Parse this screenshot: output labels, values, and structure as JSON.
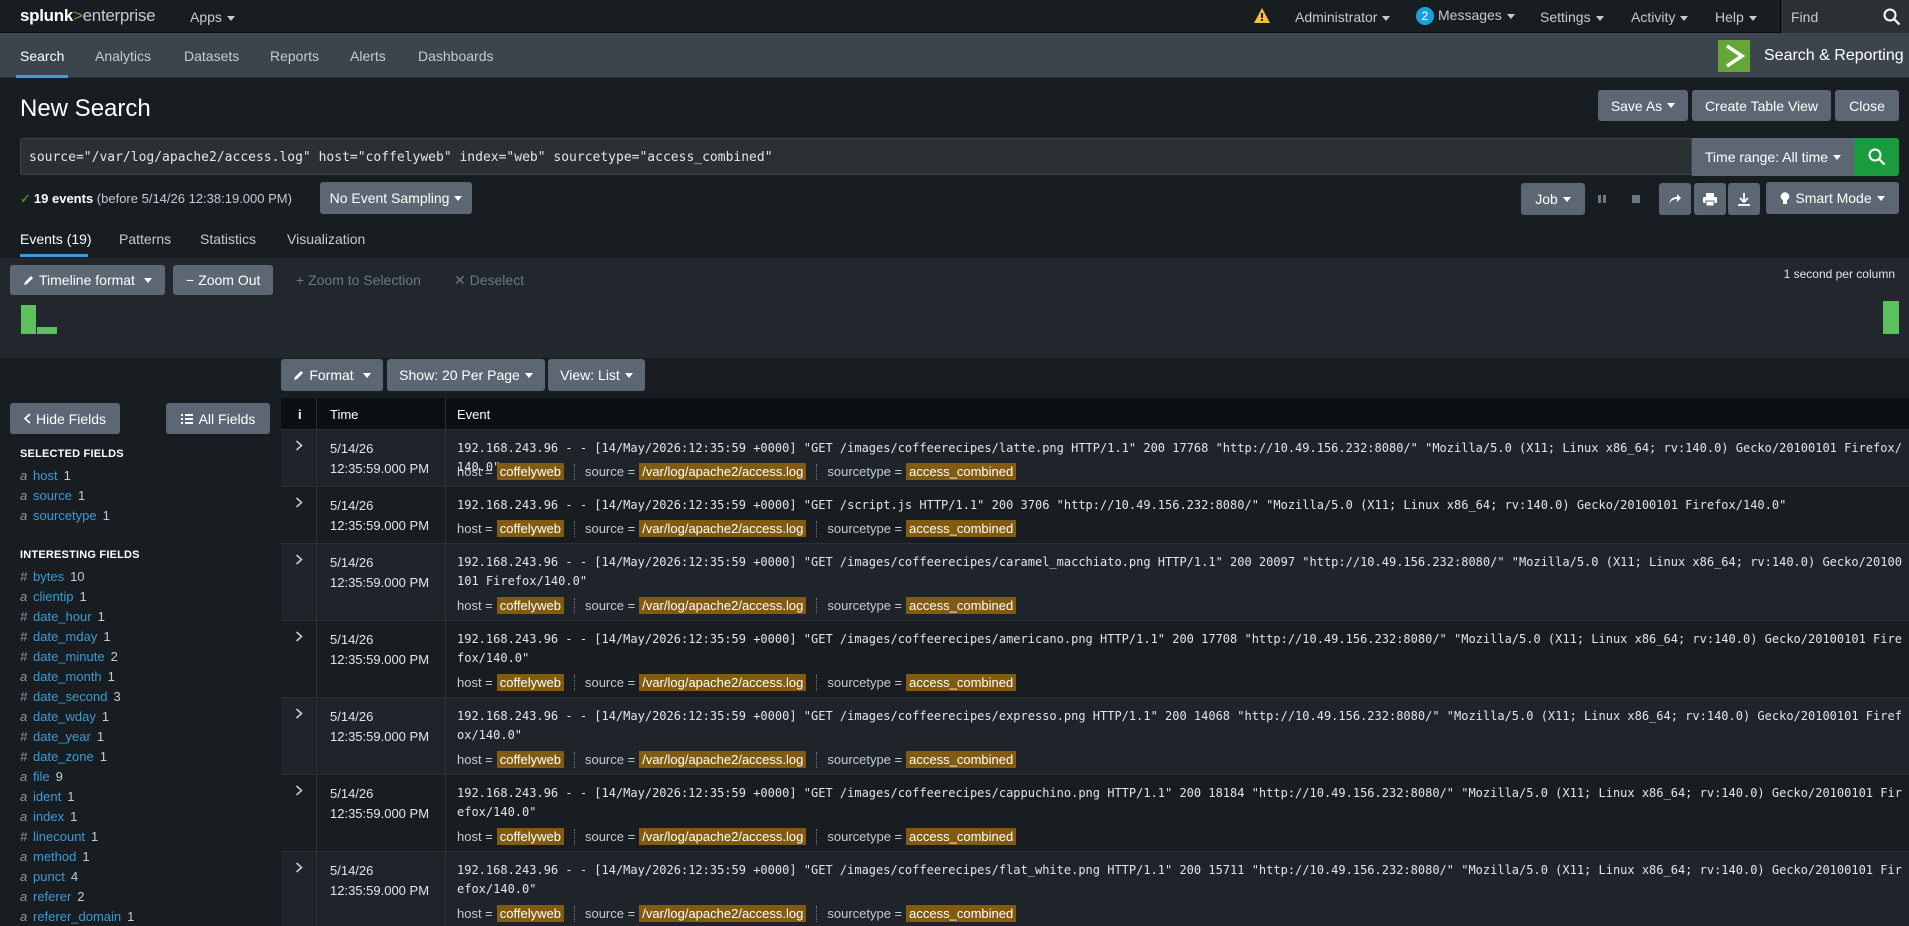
{
  "topbar": {
    "logo_splunk": "splunk",
    "logo_gt": ">",
    "logo_enterprise": "enterprise",
    "apps": "Apps",
    "user": "Administrator",
    "messages_count": "2",
    "messages": "Messages",
    "settings": "Settings",
    "activity": "Activity",
    "help": "Help",
    "find_placeholder": "Find"
  },
  "appbar": {
    "tabs": [
      "Search",
      "Analytics",
      "Datasets",
      "Reports",
      "Alerts",
      "Dashboards"
    ],
    "app_name": "Search & Reporting"
  },
  "page": {
    "title": "New Search",
    "save_as": "Save As",
    "create_table_view": "Create Table View",
    "close": "Close"
  },
  "search": {
    "query": "source=\"/var/log/apache2/access.log\" host=\"coffelyweb\" index=\"web\" sourcetype=\"access_combined\"",
    "time_range": "Time range: All time"
  },
  "status": {
    "check": "✓",
    "count": "19 events",
    "detail": "(before 5/14/26 12:38:19.000 PM)",
    "sampling": "No Event Sampling",
    "job": "Job",
    "mode": "Smart Mode"
  },
  "result_tabs": [
    "Events (19)",
    "Patterns",
    "Statistics",
    "Visualization"
  ],
  "timeline": {
    "format": "Timeline format",
    "zoom_out": "Zoom Out",
    "zoom_selection": "+ Zoom to Selection",
    "deselect": "✕ Deselect",
    "scale": "1 second per column"
  },
  "list_controls": {
    "format": "Format",
    "show": "Show: 20 Per Page",
    "view": "View: List"
  },
  "fields_panel": {
    "hide": "Hide Fields",
    "all": "All Fields",
    "selected_header": "SELECTED FIELDS",
    "selected": [
      {
        "type": "a",
        "name": "host",
        "count": "1"
      },
      {
        "type": "a",
        "name": "source",
        "count": "1"
      },
      {
        "type": "a",
        "name": "sourcetype",
        "count": "1"
      }
    ],
    "interesting_header": "INTERESTING FIELDS",
    "interesting": [
      {
        "type": "#",
        "name": "bytes",
        "count": "10"
      },
      {
        "type": "a",
        "name": "clientip",
        "count": "1"
      },
      {
        "type": "#",
        "name": "date_hour",
        "count": "1"
      },
      {
        "type": "#",
        "name": "date_mday",
        "count": "1"
      },
      {
        "type": "#",
        "name": "date_minute",
        "count": "2"
      },
      {
        "type": "a",
        "name": "date_month",
        "count": "1"
      },
      {
        "type": "#",
        "name": "date_second",
        "count": "3"
      },
      {
        "type": "a",
        "name": "date_wday",
        "count": "1"
      },
      {
        "type": "#",
        "name": "date_year",
        "count": "1"
      },
      {
        "type": "#",
        "name": "date_zone",
        "count": "1"
      },
      {
        "type": "a",
        "name": "file",
        "count": "9"
      },
      {
        "type": "a",
        "name": "ident",
        "count": "1"
      },
      {
        "type": "a",
        "name": "index",
        "count": "1"
      },
      {
        "type": "#",
        "name": "linecount",
        "count": "1"
      },
      {
        "type": "a",
        "name": "method",
        "count": "1"
      },
      {
        "type": "a",
        "name": "punct",
        "count": "4"
      },
      {
        "type": "a",
        "name": "referer",
        "count": "2"
      },
      {
        "type": "a",
        "name": "referer_domain",
        "count": "1"
      }
    ]
  },
  "events_table": {
    "col_info": "i",
    "col_time": "Time",
    "col_event": "Event",
    "meta_labels": {
      "host": "host =",
      "source": "source =",
      "sourcetype": "sourcetype ="
    },
    "rows": [
      {
        "date": "5/14/26",
        "time": "12:35:59.000 PM",
        "raw": "192.168.243.96 - - [14/May/2026:12:35:59 +0000] \"GET /images/coffeerecipes/latte.png HTTP/1.1\" 200 17768 \"http://10.49.156.232:8080/\" \"Mozilla/5.0 (X11; Linux x86_64; rv:140.0) Gecko/20100101 Firefox/140.0\"",
        "host": "coffelyweb",
        "source": "/var/log/apache2/access.log",
        "sourcetype": "access_combined"
      },
      {
        "date": "5/14/26",
        "time": "12:35:59.000 PM",
        "raw": "192.168.243.96 - - [14/May/2026:12:35:59 +0000] \"GET /script.js HTTP/1.1\" 200 3706 \"http://10.49.156.232:8080/\" \"Mozilla/5.0 (X11; Linux x86_64; rv:140.0) Gecko/20100101 Firefox/140.0\"",
        "host": "coffelyweb",
        "source": "/var/log/apache2/access.log",
        "sourcetype": "access_combined"
      },
      {
        "date": "5/14/26",
        "time": "12:35:59.000 PM",
        "raw": "192.168.243.96 - - [14/May/2026:12:35:59 +0000] \"GET /images/coffeerecipes/caramel_macchiato.png HTTP/1.1\" 200 20097 \"http://10.49.156.232:8080/\" \"Mozilla/5.0 (X11; Linux x86_64; rv:140.0) Gecko/20100101 Firefox/140.0\"",
        "host": "coffelyweb",
        "source": "/var/log/apache2/access.log",
        "sourcetype": "access_combined"
      },
      {
        "date": "5/14/26",
        "time": "12:35:59.000 PM",
        "raw": "192.168.243.96 - - [14/May/2026:12:35:59 +0000] \"GET /images/coffeerecipes/americano.png HTTP/1.1\" 200 17708 \"http://10.49.156.232:8080/\" \"Mozilla/5.0 (X11; Linux x86_64; rv:140.0) Gecko/20100101 Firefox/140.0\"",
        "host": "coffelyweb",
        "source": "/var/log/apache2/access.log",
        "sourcetype": "access_combined"
      },
      {
        "date": "5/14/26",
        "time": "12:35:59.000 PM",
        "raw": "192.168.243.96 - - [14/May/2026:12:35:59 +0000] \"GET /images/coffeerecipes/expresso.png HTTP/1.1\" 200 14068 \"http://10.49.156.232:8080/\" \"Mozilla/5.0 (X11; Linux x86_64; rv:140.0) Gecko/20100101 Firefox/140.0\"",
        "host": "coffelyweb",
        "source": "/var/log/apache2/access.log",
        "sourcetype": "access_combined"
      },
      {
        "date": "5/14/26",
        "time": "12:35:59.000 PM",
        "raw": "192.168.243.96 - - [14/May/2026:12:35:59 +0000] \"GET /images/coffeerecipes/cappuchino.png HTTP/1.1\" 200 18184 \"http://10.49.156.232:8080/\" \"Mozilla/5.0 (X11; Linux x86_64; rv:140.0) Gecko/20100101 Firefox/140.0\"",
        "host": "coffelyweb",
        "source": "/var/log/apache2/access.log",
        "sourcetype": "access_combined"
      },
      {
        "date": "5/14/26",
        "time": "12:35:59.000 PM",
        "raw": "192.168.243.96 - - [14/May/2026:12:35:59 +0000] \"GET /images/coffeerecipes/flat_white.png HTTP/1.1\" 200 15711 \"http://10.49.156.232:8080/\" \"Mozilla/5.0 (X11; Linux x86_64; rv:140.0) Gecko/20100101 Firefox/140.0\"",
        "host": "coffelyweb",
        "source": "/var/log/apache2/access.log",
        "sourcetype": "access_combined"
      }
    ]
  },
  "colors": {
    "accent_green": "#65a637",
    "search_green": "#1a9c3e",
    "tab_blue": "#3d9bd8",
    "field_highlight": "#825b10"
  }
}
